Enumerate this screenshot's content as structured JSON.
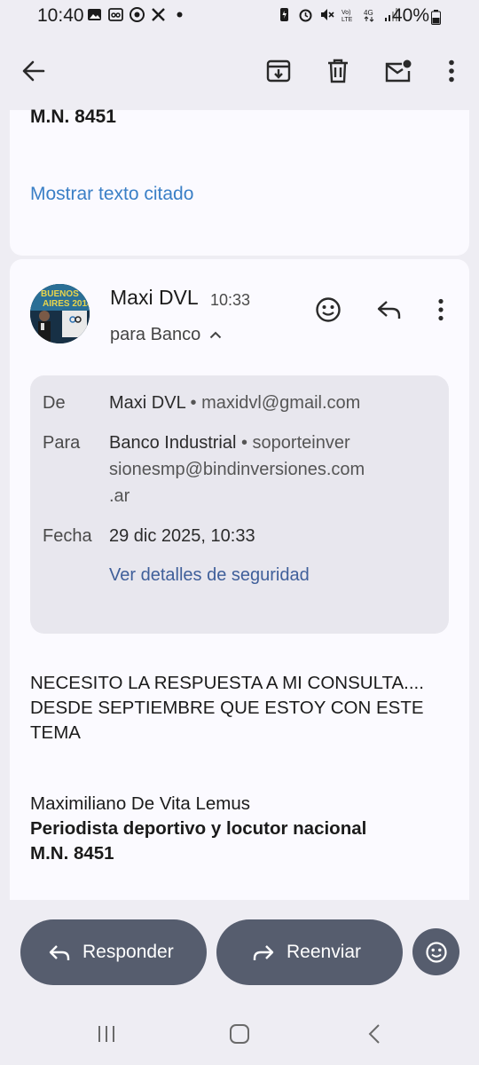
{
  "status_bar": {
    "time": "10:40",
    "battery": "40%",
    "left_icons": [
      "gallery-icon",
      "voicemail-icon",
      "chrome-icon",
      "x-icon",
      "dot-icon"
    ],
    "right_icons": [
      "data-saver-icon",
      "alarm-icon",
      "mute-icon",
      "volte-icon",
      "4g-icon",
      "signal-icon"
    ]
  },
  "toolbar": {
    "icons": [
      "back-arrow-icon",
      "archive-icon",
      "delete-icon",
      "mark-unread-icon",
      "more-vert-icon"
    ]
  },
  "previous_message": {
    "signature_tail": "M.N. 8451",
    "show_quoted": "Mostrar texto citado"
  },
  "message": {
    "sender": "Maxi DVL",
    "time": "10:33",
    "recipient_summary": "para Banco",
    "details": {
      "from_label": "De",
      "from_name": "Maxi DVL",
      "from_email": "maxidvl@gmail.com",
      "to_label": "Para",
      "to_name": "Banco Industrial",
      "to_email_line1": "soporteinver",
      "to_email_line2": "sionesmp@bindinversiones.com",
      "to_email_line3": ".ar",
      "date_label": "Fecha",
      "date_value": "29 dic 2025, 10:33",
      "security_link": "Ver detalles de seguridad"
    },
    "body_line1": "NECESITO LA RESPUESTA A MI CONSULTA....",
    "body_line2": "DESDE SEPTIEMBRE QUE ESTOY CON ESTE",
    "body_line3": "TEMA",
    "signature_name": "Maximiliano De Vita Lemus",
    "signature_title": "Periodista deportivo y locutor nacional",
    "signature_mn": "M.N. 8451"
  },
  "actions": {
    "reply": "Responder",
    "forward": "Reenviar"
  },
  "colors": {
    "background": "#eeedf3",
    "card": "#fbfaff",
    "link": "#3a7fc6",
    "action_button": "#565d6e"
  }
}
